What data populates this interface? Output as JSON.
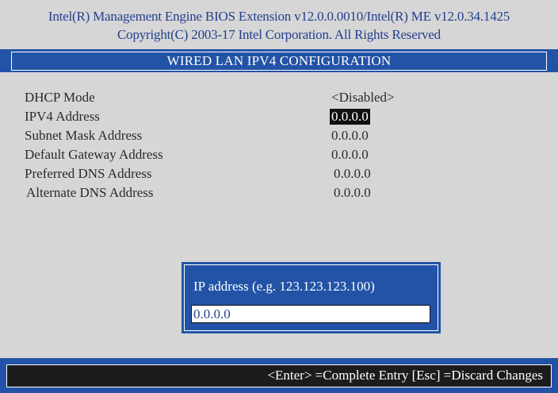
{
  "header": {
    "line1": "Intel(R) Management Engine BIOS Extension v12.0.0.0010/Intel(R) ME v12.0.34.1425",
    "line2": "Copyright(C) 2003-17 Intel Corporation. All Rights Reserved"
  },
  "title": "WIRED LAN IPV4 CONFIGURATION",
  "settings": [
    {
      "label": "DHCP Mode",
      "value": "<Disabled>"
    },
    {
      "label": "IPV4 Address",
      "value": "0.0.0.0",
      "selected": true
    },
    {
      "label": "Subnet Mask Address",
      "value": "0.0.0.0"
    },
    {
      "label": "Default Gateway Address",
      "value": "0.0.0.0"
    },
    {
      "label": "Preferred DNS Address",
      "value": "0.0.0.0"
    },
    {
      "label": "Alternate DNS Address",
      "value": "0.0.0.0"
    }
  ],
  "dialog": {
    "prompt": "IP address (e.g. 123.123.123.100)",
    "input_value": "0.0.0.0"
  },
  "status": {
    "hint": "<Enter> =Complete Entry  [Esc] =Discard Changes"
  },
  "colors": {
    "background": "#d6d6d6",
    "accent_blue": "#2253a6",
    "header_text": "#24408f",
    "selection_bg": "#111111",
    "status_bg": "#1c1c1c"
  }
}
